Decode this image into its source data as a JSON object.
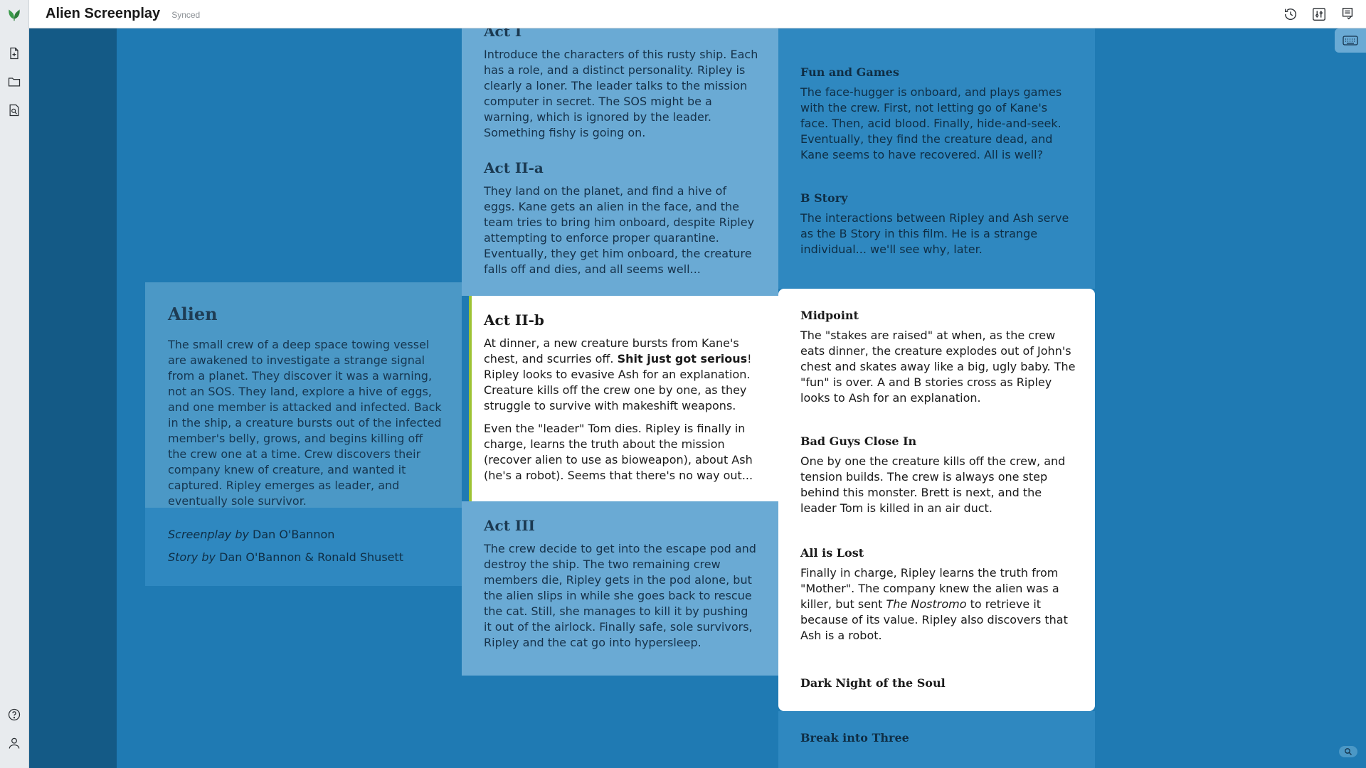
{
  "header": {
    "title": "Alien Screenplay",
    "status": "Synced"
  },
  "rail": {
    "icons": [
      "logo-icon",
      "new-document-icon",
      "open-folder-icon",
      "search-document-icon",
      "help-icon",
      "user-icon"
    ]
  },
  "header_icons": [
    "history-icon",
    "settings-sliders-icon",
    "checklist-icon"
  ],
  "column1": {
    "title": "Alien",
    "summary": "The small crew of a deep space towing vessel are awakened to investigate a strange signal from a planet. They discover it was a warning, not an SOS. They land, explore a hive of eggs, and one member is attacked and infected. Back in the ship, a creature bursts out of the infected member's belly, grows, and begins killing off the crew one at a time. Crew discovers their company knew of creature, and wanted it captured. Ripley emerges as leader, and eventually sole survivor.",
    "credit1_label": "Screenplay by",
    "credit1_name": "Dan O'Bannon",
    "credit2_label": "Story by",
    "credit2_name": "Dan O'Bannon & Ronald Shusett"
  },
  "column2": {
    "act1_title": "Act I",
    "act1_text": "Introduce the characters of this rusty ship. Each has a role, and a distinct personality. Ripley is clearly a loner. The leader talks to the mission computer in secret. The SOS might be a warning, which is ignored by the leader. Something fishy is going on.",
    "act2a_title": "Act II-a",
    "act2a_text": "They land on the planet, and find a hive of eggs. Kane gets an alien in the face, and the team tries to bring him onboard, despite Ripley attempting to enforce proper quarantine. Eventually, they get him onboard, the creature falls off and dies, and all seems well...",
    "act2b_title": "Act II-b",
    "act2b_text_pre": "At dinner, a new creature bursts from Kane's chest, and scurries off. ",
    "act2b_text_bold": "Shit just got serious",
    "act2b_text_post": "! Ripley looks to evasive Ash for an explanation. Creature kills off the crew one by one, as they struggle to survive with makeshift weapons.",
    "act2b_text2": "Even the \"leader\" Tom dies. Ripley is finally in charge, learns the truth about the mission (recover alien to use as bioweapon), about Ash (he's a robot). Seems that there's no way out...",
    "act3_title": "Act III",
    "act3_text": "The crew decide to get into the escape pod and destroy the ship. The two remaining crew members die, Ripley gets in the pod alone, but the alien slips in while she goes back to rescue the cat. Still, she manages to kill it by pushing it out of the airlock. Finally safe, sole survivors, Ripley and the cat go into hypersleep."
  },
  "column3": {
    "fun_title": "Fun and Games",
    "fun_text": "The face-hugger is onboard, and plays games with the crew. First, not letting go of Kane's face. Then, acid blood. Finally, hide-and-seek. Eventually, they find the creature dead, and Kane seems to have recovered. All is well?",
    "bstory_title": "B Story",
    "bstory_text": "The interactions between Ripley and Ash serve as the B Story in this film. He is a strange individual... we'll see why, later.",
    "midpoint_title": "Midpoint",
    "midpoint_text": "The \"stakes are raised\" at when, as the crew eats dinner, the creature explodes out of John's chest and skates away like a big, ugly baby. The \"fun\" is over. A and B stories cross as Ripley looks to Ash for an explanation.",
    "badguys_title": "Bad Guys Close In",
    "badguys_text": "One by one the creature kills off the crew, and tension builds. The crew is always one step behind this monster. Brett is next, and the leader Tom is killed in an air duct.",
    "alllost_title": "All is Lost",
    "alllost_text_pre": "Finally in charge, Ripley learns the truth from \"Mother\". The company knew the alien was a killer, but sent ",
    "alllost_text_italic": "The Nostromo",
    "alllost_text_post": " to retrieve it because of its value. Ripley also discovers that Ash is a robot.",
    "darknight_title": "Dark Night of the Soul",
    "breakthree_title": "Break into Three"
  },
  "colors": {
    "canvas": "#1f7ab3",
    "dark_strip": "#145a86",
    "active_border": "#9ec334",
    "logo": "#3a9a4a"
  }
}
